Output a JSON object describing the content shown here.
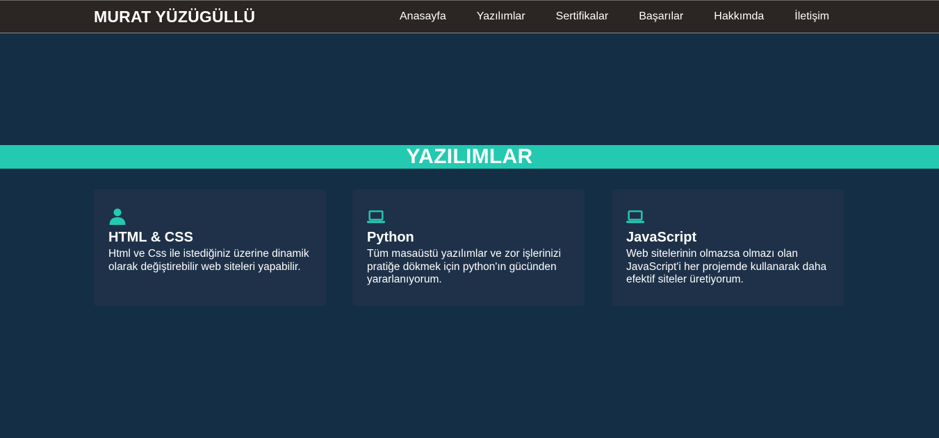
{
  "header": {
    "brand": "MURAT YÜZÜGÜLLÜ",
    "nav": [
      {
        "label": "Anasayfa"
      },
      {
        "label": "Yazılımlar"
      },
      {
        "label": "Sertifikalar"
      },
      {
        "label": "Başarılar"
      },
      {
        "label": "Hakkımda"
      },
      {
        "label": "İletişim"
      }
    ]
  },
  "section": {
    "title": "YAZILIMLAR"
  },
  "cards": [
    {
      "icon": "user-icon",
      "title": "HTML & CSS",
      "text": "Html ve Css ile istediğiniz üzerine dinamik olarak değiştirebilir web siteleri yapabilir."
    },
    {
      "icon": "laptop-icon",
      "title": "Python",
      "text": "Tüm masaüstü yazılımlar ve zor işlerinizi pratiğe dökmek için python'ın gücünden yararlanıyorum."
    },
    {
      "icon": "laptop-icon",
      "title": "JavaScript",
      "text": "Web sitelerinin olmazsa olmazı olan JavaScript'i her projemde kullanarak daha efektif siteler üretiyorum."
    }
  ],
  "colors": {
    "background": "#132e45",
    "navbar": "#2b2523",
    "accent": "#23c9b0",
    "card": "#1e3148",
    "text": "#ffffff"
  }
}
